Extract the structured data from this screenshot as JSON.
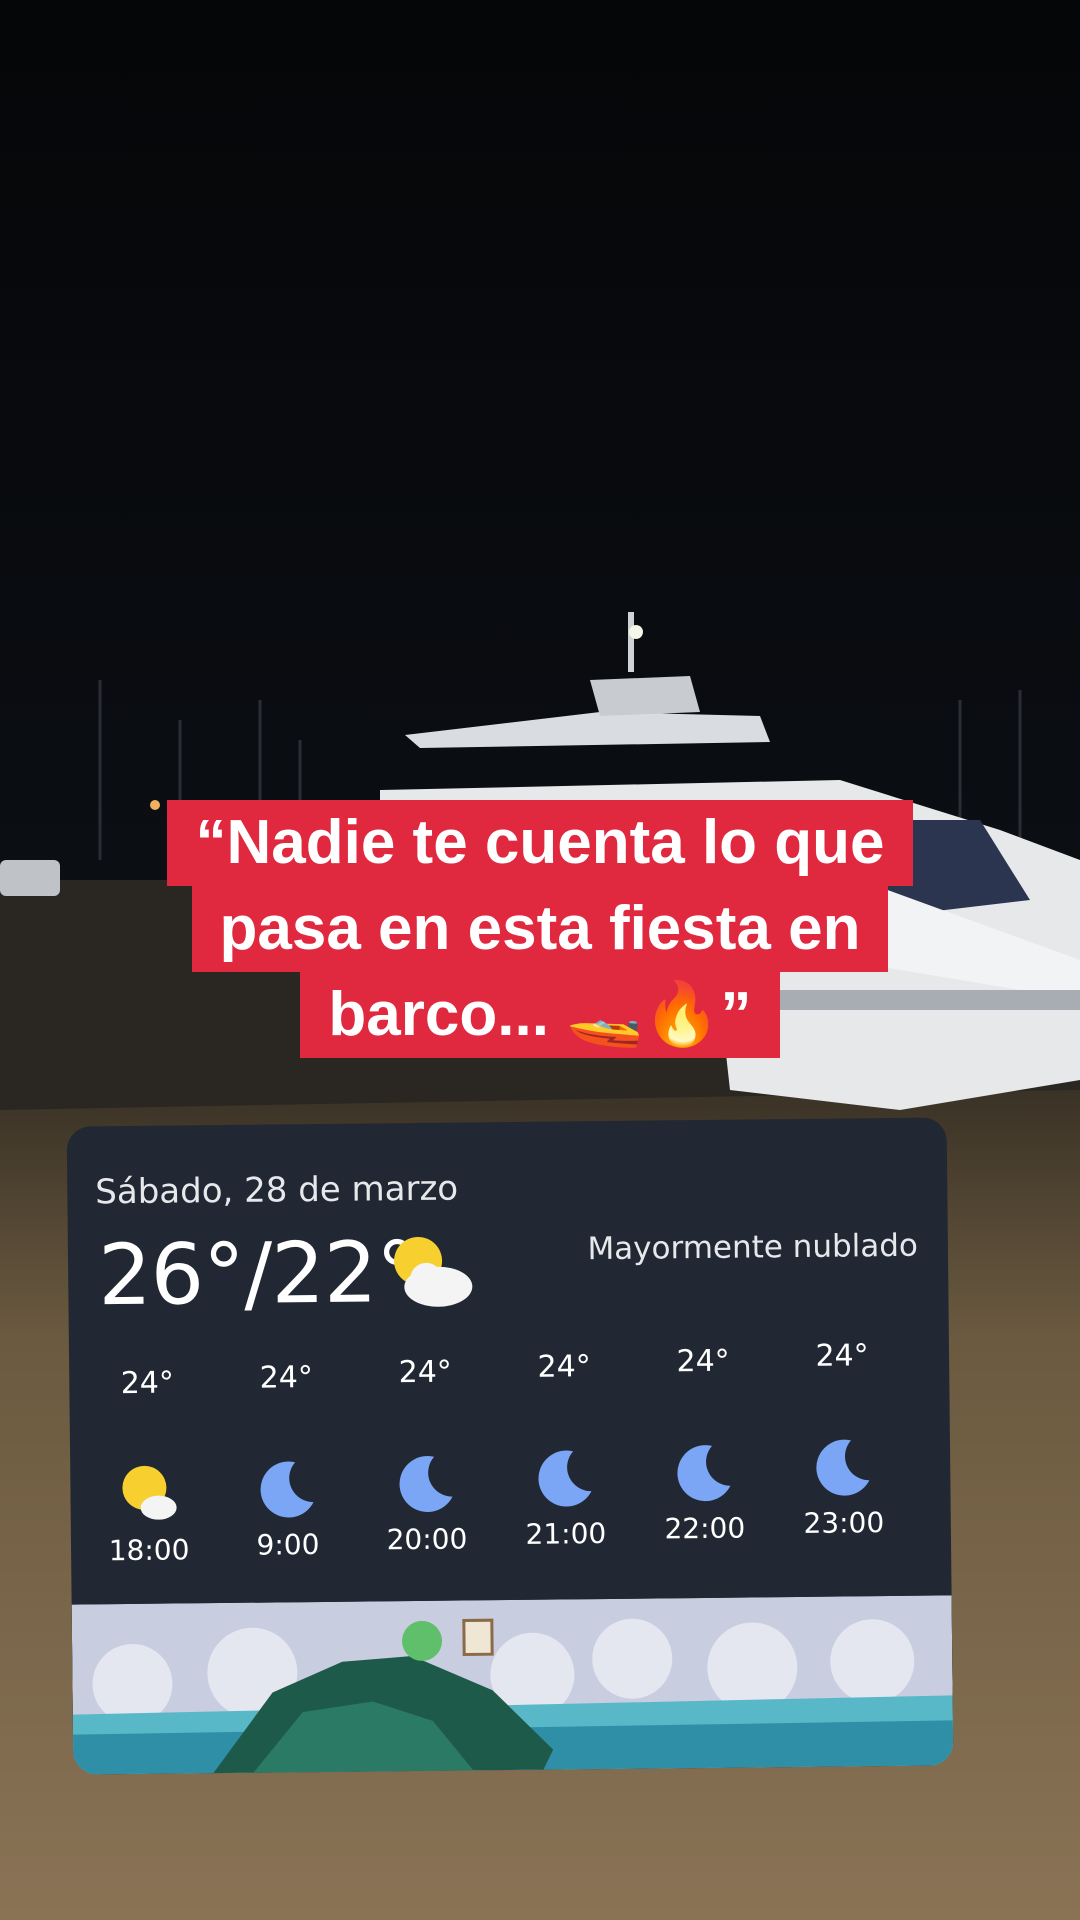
{
  "caption": {
    "line1": "“Nadie te cuenta lo que",
    "line2": "pasa en esta fiesta en",
    "line3": "barco... 🚤🔥”"
  },
  "weather": {
    "date": "Sábado, 28 de marzo",
    "temp_range": "26°/22°",
    "condition": "Mayormente nublado",
    "main_icon": "partly-cloudy-icon",
    "hours": [
      {
        "temp": "24°",
        "time": "18:00",
        "icon": "partly-cloudy-icon"
      },
      {
        "temp": "24°",
        "time": "9:00",
        "icon": "moon-icon"
      },
      {
        "temp": "24°",
        "time": "20:00",
        "icon": "moon-icon"
      },
      {
        "temp": "24°",
        "time": "21:00",
        "icon": "moon-icon"
      },
      {
        "temp": "24°",
        "time": "22:00",
        "icon": "moon-icon"
      },
      {
        "temp": "24°",
        "time": "23:00",
        "icon": "moon-icon"
      }
    ]
  },
  "colors": {
    "caption_bg": "#e0283f",
    "widget_bg": "#222833",
    "moon": "#7aa6f5",
    "sun": "#f7cf2e"
  }
}
